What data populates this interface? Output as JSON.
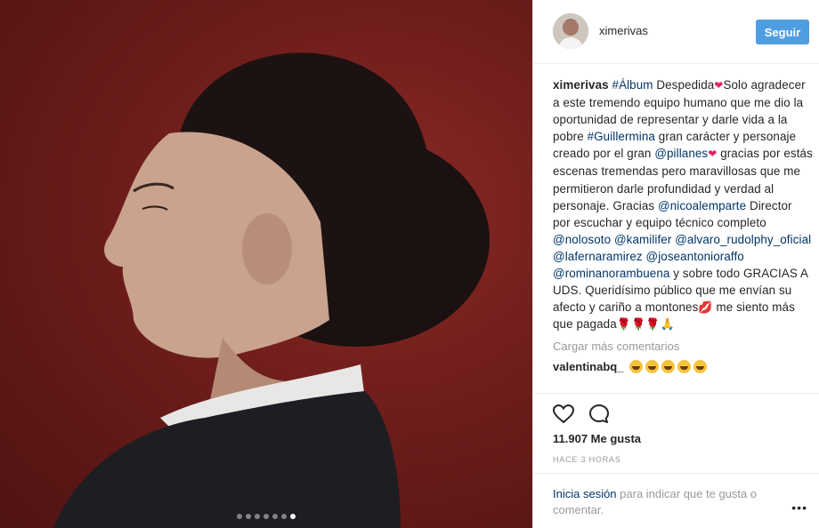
{
  "post": {
    "username": "ximerivas",
    "follow_label": "Seguir",
    "carousel": {
      "count": 7,
      "active_index": 6
    }
  },
  "caption": {
    "user": "ximerivas",
    "t1": " ",
    "tag_album": "#Álbum",
    "t2": " Despedida",
    "t3": "Solo agradecer a este tremendo equipo humano que me dio la oportunidad de representar y darle vida a la pobre ",
    "tag_guillermina": "#Guillermina",
    "t4": " gran carácter y personaje creado por el gran ",
    "m_pillanes": "@pillanes",
    "t5": "gracias por estás escenas tremendas pero maravillosas que me permitieron darle profundidad y verdad al personaje. Gracias ",
    "m_nicoalemparte": "@nicoalemparte",
    "t6": " Director por escuchar y equipo técnico completo ",
    "m_nolosoto": "@nolosoto",
    "m_kamilifer": "@kamilifer",
    "m_alvaro": "@alvaro_rudolphy_oficial",
    "m_lafernaramirez": "@lafernaramirez",
    "m_joseantonioraffo": "@joseantonioraffo",
    "m_rominanorambuena": "@rominanorambuena",
    "t7": " y sobre todo GRACIAS A UDS. Queridísimo público que me envían su afecto y cariño a montones",
    "t8": " me siento más que pagada"
  },
  "load_more_label": "Cargar más comentarios",
  "comment": {
    "user": "valentinabq_"
  },
  "likes_label": "11.907 Me gusta",
  "time_label": "HACE 3 HORAS",
  "login": {
    "link": "Inicia sesión",
    "text": " para indicar que te gusta o comentar."
  },
  "more_label": "•••",
  "icons": {
    "like": "heart-outline-icon",
    "comment": "speech-bubble-icon"
  },
  "colors": {
    "follow_button": "#4f9ee2",
    "link": "#003569",
    "background_photo": "#6e1d1b"
  }
}
